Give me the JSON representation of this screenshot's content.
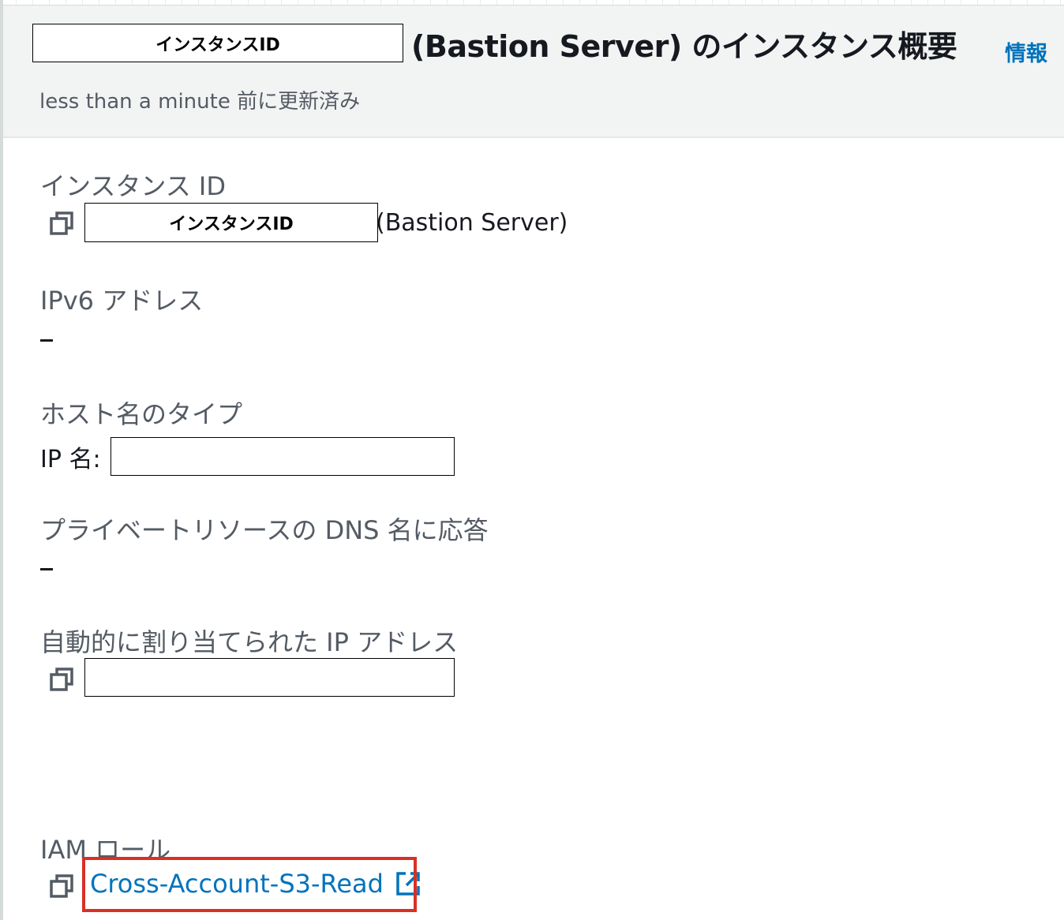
{
  "header": {
    "id_redaction_label": "インスタンスID",
    "title": "(Bastion Server) のインスタンス概要",
    "info_link": "情報",
    "subtitle": "less than a minute 前に更新済み"
  },
  "fields": {
    "instance_id": {
      "label": "インスタンス ID",
      "redaction_label": "インスタンスID",
      "suffix": "(Bastion Server)"
    },
    "ipv6": {
      "label": "IPv6 アドレス",
      "value": "–"
    },
    "hostname_type": {
      "label": "ホスト名のタイプ",
      "value_prefix": "IP 名:"
    },
    "private_dns": {
      "label": "プライベートリソースの DNS 名に応答",
      "value": "–"
    },
    "auto_ip": {
      "label": "自動的に割り当てられた IP アドレス"
    },
    "iam_role": {
      "label": "IAM ロール",
      "value": "Cross-Account-S3-Read"
    }
  },
  "icons": {
    "copy": "copy-icon",
    "external": "external-link-icon"
  },
  "colors": {
    "link": "#0073bb",
    "label": "#545b64",
    "text": "#16191f",
    "header_bg": "#f2f3f3",
    "highlight": "#d93025"
  }
}
